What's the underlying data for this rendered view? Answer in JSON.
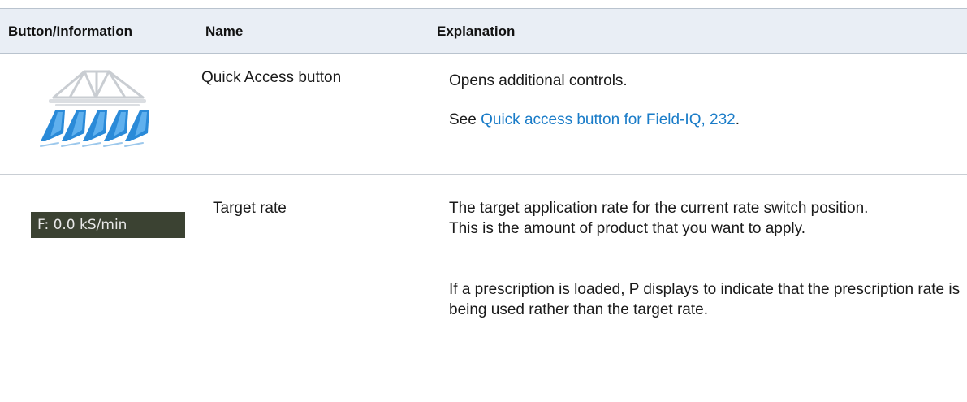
{
  "table": {
    "headers": {
      "col1": "Button/Information",
      "col2": "Name",
      "col3": "Explanation"
    },
    "rows": [
      {
        "icon": "quick-access-sprayer-icon",
        "name": "Quick Access button",
        "explanation_1": "Opens additional controls.",
        "see_prefix": "See ",
        "link_text": "Quick access button for Field-IQ, 232",
        "see_suffix": "."
      },
      {
        "badge": "F: 0.0 kS/min",
        "name": "Target rate",
        "explanation_1": "The target application rate for the current rate switch position.",
        "explanation_1b": "This is the amount of product that you want to apply.",
        "explanation_2": "If a prescription is loaded, P displays to indicate that the prescription rate is being used rather than the target rate."
      }
    ]
  },
  "colors": {
    "header_bg": "#e9eef5",
    "link": "#1a7cc8",
    "badge_bg": "#3b4232",
    "badge_text": "#e8e8e8",
    "spray_blue": "#2a8ad8"
  }
}
